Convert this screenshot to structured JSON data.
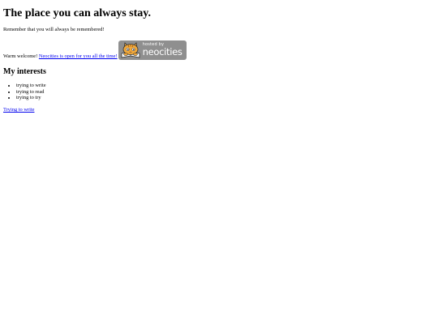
{
  "page": {
    "title": "The place you can always stay.",
    "tagline": "Remember that you will always be remembered!",
    "welcome_text": "Warm welcome!",
    "welcome_link": "Neocities is open for you all the time!",
    "badge": {
      "hosted_label": "hosted by",
      "brand_label": "neocities",
      "background_color": "#8f8f8f",
      "icon": "neocities-cat-icon"
    },
    "interests_heading": "My interests",
    "interests": [
      "trying to write",
      "trying to read",
      "trying to try"
    ],
    "footer_link": "Trying to write"
  },
  "colors": {
    "link": "#0000ee",
    "text": "#000000",
    "background": "#ffffff"
  }
}
